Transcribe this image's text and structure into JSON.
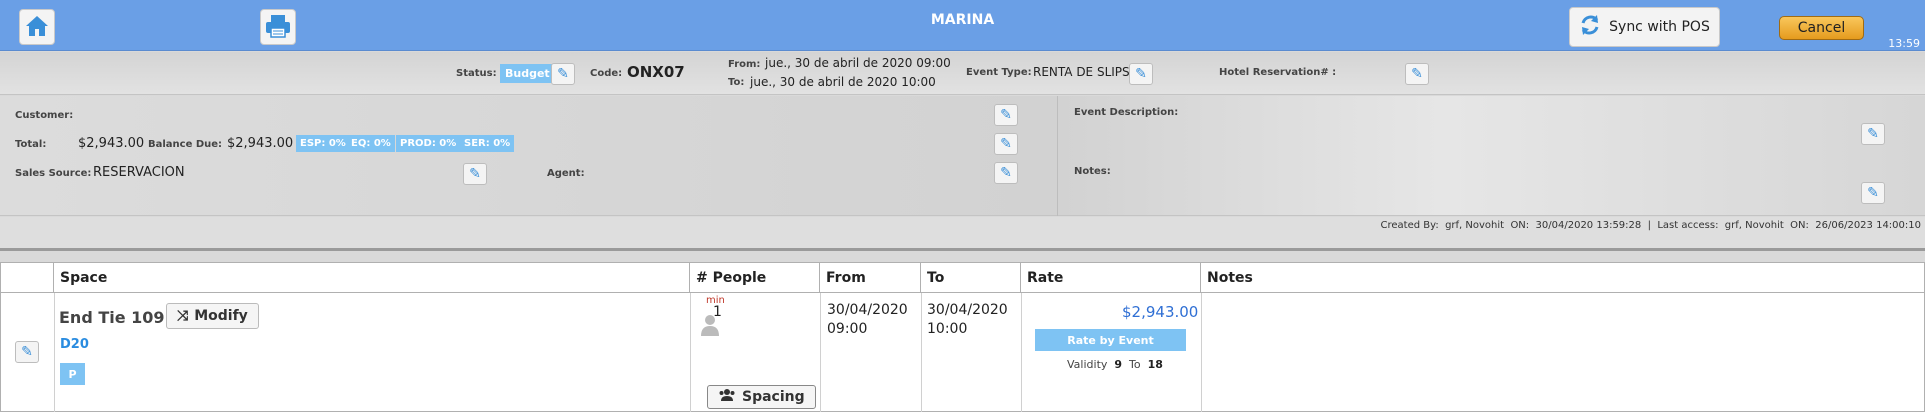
{
  "topbar": {
    "title": "MARINA",
    "sync_label": "Sync with POS",
    "cancel_label": "Cancel",
    "time": "13:59",
    "icons": {
      "home": "home-icon",
      "print": "printer-icon",
      "sync": "refresh-icon"
    }
  },
  "header": {
    "status_label": "Status:",
    "status_value": "Budget",
    "code_label": "Code:",
    "code_value": "ONX07",
    "from_label": "From:",
    "from_value": "jue., 30 de abril de 2020  09:00",
    "to_label": "To:",
    "to_value": "jue., 30 de abril de 2020  10:00",
    "event_type_label": "Event Type:",
    "event_type_value": "RENTA DE SLIPS",
    "hotel_label": "Hotel Reservation# :"
  },
  "details": {
    "customer_label": "Customer:",
    "total_label": "Total:",
    "total_value": "$2,943.00",
    "balance_label": "Balance Due:",
    "balance_value": "$2,943.00",
    "badges": [
      "ESP: 0%",
      "EQ: 0%",
      "PROD: 0%",
      "SER: 0%"
    ],
    "sales_source_label": "Sales Source:",
    "sales_source_value": "RESERVACION",
    "agent_label": "Agent:",
    "event_desc_label": "Event Description:",
    "notes_label": "Notes:"
  },
  "meta": {
    "created_by_label": "Created By:",
    "created_by": "grf, Novohit",
    "on_label": "ON:",
    "created_on": "30/04/2020 13:59:28",
    "sep": "|",
    "last_access_label": "Last access:",
    "last_access_by": "grf, Novohit",
    "last_access_on": "26/06/2023 14:00:10"
  },
  "table": {
    "headers": [
      "Space",
      "# People",
      "From",
      "To",
      "Rate",
      "Notes"
    ],
    "row": {
      "space_name": "End Tie 109'",
      "modify_label": "Modify",
      "code": "D20",
      "badge": "P",
      "min_label": "min",
      "people": "1",
      "spacing_label": "Spacing",
      "from_date": "30/04/2020",
      "from_time": "09:00",
      "to_date": "30/04/2020",
      "to_time": "10:00",
      "rate": "$2,943.00",
      "rate_button": "Rate by Event",
      "validity_label": "Validity",
      "validity_from": "9",
      "validity_to_label": "To",
      "validity_to": "18",
      "notes": ""
    }
  },
  "colors": {
    "topbar": "#6a9fe6",
    "badge": "#7ec3f3",
    "link": "#2a8ce0",
    "cancel": "#f0b03a"
  }
}
